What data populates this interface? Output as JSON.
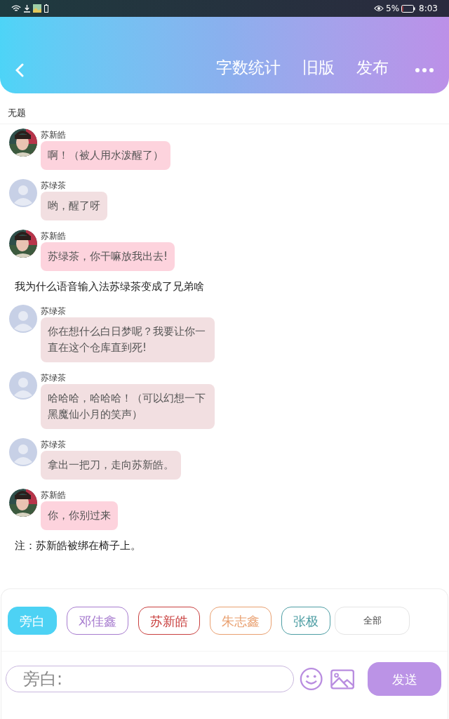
{
  "status_bar": {
    "battery": "5%",
    "time": "8:03"
  },
  "header": {
    "actions": [
      "字数统计",
      "旧版",
      "发布"
    ]
  },
  "title": "无题",
  "messages": [
    {
      "kind": "bubble",
      "photo_avatar": true,
      "speaker": "苏新皓",
      "text": "啊！（被人用水泼醒了）",
      "color": "#fdd3dd"
    },
    {
      "kind": "bubble",
      "photo_avatar": false,
      "speaker": "苏绿茶",
      "text": "哟，醒了呀",
      "color": "#f2dfe1"
    },
    {
      "kind": "bubble",
      "photo_avatar": true,
      "speaker": "苏新皓",
      "text": "苏绿茶，你干嘛放我出去!",
      "color": "#fdd3dd"
    },
    {
      "kind": "narration",
      "text": "我为什么语音输入法苏绿茶变成了兄弟啥"
    },
    {
      "kind": "bubble",
      "photo_avatar": false,
      "speaker": "苏绿茶",
      "text": "你在想什么白日梦呢？我要让你一直在这个仓库直到死!",
      "color": "#f2dfe1"
    },
    {
      "kind": "bubble",
      "photo_avatar": false,
      "speaker": "苏绿茶",
      "text": "哈哈哈，哈哈哈！（可以幻想一下黑魔仙小月的笑声）",
      "color": "#f2dfe1"
    },
    {
      "kind": "bubble",
      "photo_avatar": false,
      "speaker": "苏绿茶",
      "text": "拿出一把刀，走向苏新皓。",
      "color": "#f2dfe1"
    },
    {
      "kind": "bubble",
      "photo_avatar": true,
      "speaker": "苏新皓",
      "text": "你，你别过来",
      "color": "#fdd3dd"
    },
    {
      "kind": "narration",
      "text": "注：苏新皓被绑在椅子上。"
    }
  ],
  "characters": [
    {
      "name": "旁白",
      "selected": true,
      "color": "#4dd2f4"
    },
    {
      "name": "邓佳鑫",
      "selected": false,
      "color": "#a77ccf"
    },
    {
      "name": "苏新皓",
      "selected": false,
      "color": "#c9403f"
    },
    {
      "name": "朱志鑫",
      "selected": false,
      "color": "#e9a070"
    },
    {
      "name": "张极",
      "selected": false,
      "color": "#4e9ea4"
    }
  ],
  "all_button": "全部",
  "input": {
    "placeholder": "旁白:"
  },
  "send_button": "发送"
}
